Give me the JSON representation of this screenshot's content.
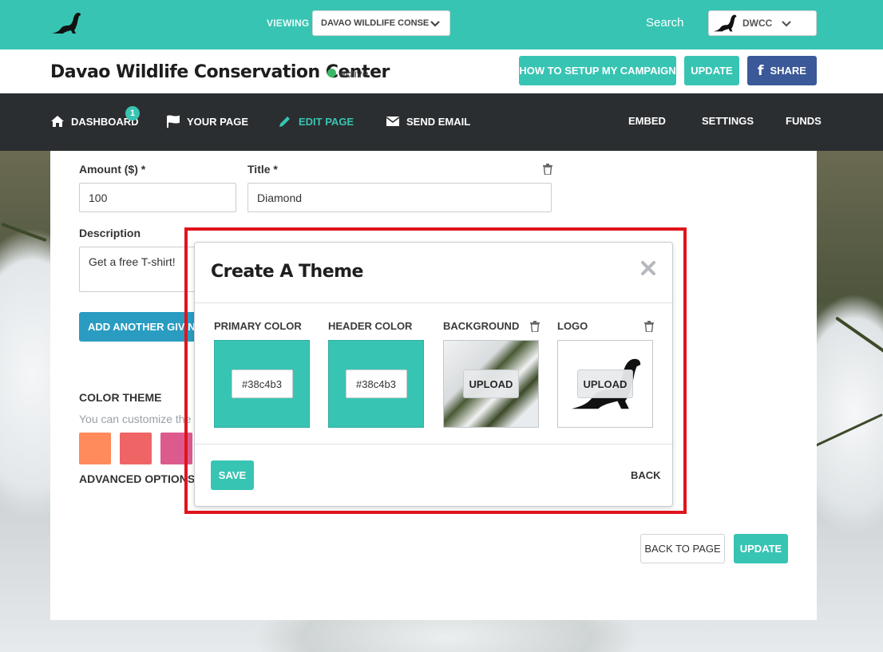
{
  "topbar": {
    "viewing_label": "VIEWING",
    "viewing_value": "DAVAO WILDLIFE CONSE...",
    "search_label": "Search",
    "account_label": "DWCC"
  },
  "titlebar": {
    "page_title": "Davao Wildlife Conservation Center",
    "status": "active",
    "how_to_label": "HOW TO SETUP MY CAMPAIGN",
    "update_label": "UPDATE",
    "share_label": "SHARE"
  },
  "nav": {
    "dashboard": "DASHBOARD",
    "dashboard_badge": "1",
    "your_page": "YOUR PAGE",
    "edit_page": "EDIT PAGE",
    "send_email": "SEND EMAIL",
    "embed": "EMBED",
    "settings": "SETTINGS",
    "funds": "FUNDS"
  },
  "form": {
    "amount_label": "Amount ($) *",
    "amount_value": "100",
    "title_label": "Title *",
    "title_value": "Diamond",
    "description_label": "Description",
    "description_value": "Get a free T-shirt!",
    "add_level_label": "ADD ANOTHER GIVING LEVEL",
    "color_theme_label": "COLOR THEME",
    "color_theme_hint": "You can customize the primary color",
    "swatches": [
      "#ff8a5c",
      "#ef6566",
      "#dc5a8e"
    ],
    "advanced_options": "ADVANCED OPTIONS",
    "back_to_page_label": "BACK TO PAGE",
    "update_label": "UPDATE"
  },
  "modal": {
    "title": "Create A Theme",
    "primary_color_label": "PRIMARY COLOR",
    "primary_color_value": "#38c4b3",
    "header_color_label": "HEADER COLOR",
    "header_color_value": "#38c4b3",
    "background_label": "BACKGROUND",
    "logo_label": "LOGO",
    "upload_label": "UPLOAD",
    "save_label": "SAVE",
    "back_label": "BACK"
  },
  "colors": {
    "accent": "#38c4b3",
    "nav_bg": "#2b2e30",
    "facebook": "#3b5998",
    "add_level_blue": "#2a9cc2",
    "status_green": "#3cb868",
    "highlight_red": "#e0141c"
  },
  "icons": [
    "ferret-logo-icon",
    "chevron-down-icon",
    "home-icon",
    "flag-icon",
    "pencil-icon",
    "envelope-icon",
    "trash-icon",
    "close-icon",
    "facebook-icon"
  ]
}
